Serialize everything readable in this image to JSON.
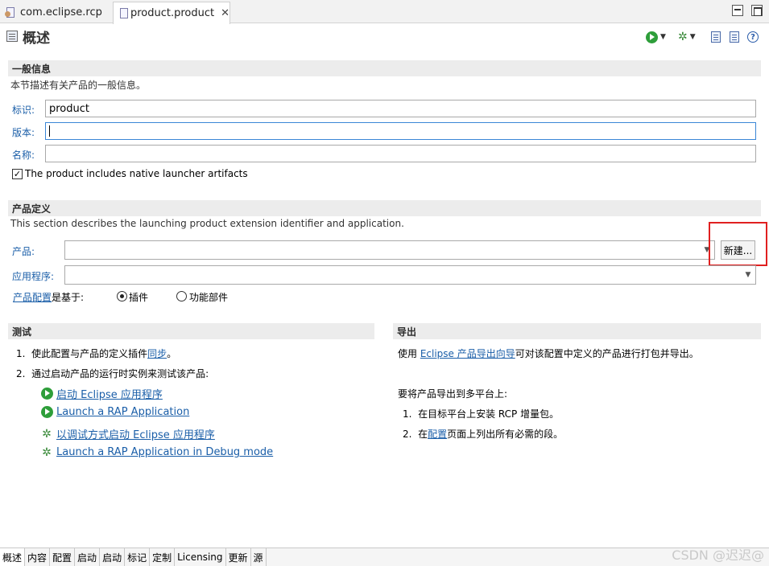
{
  "tabs": [
    {
      "label": "com.eclipse.rcp",
      "icon": "plugin-manifest-icon"
    },
    {
      "label": "product.product",
      "icon": "product-file-icon",
      "close": "✕"
    }
  ],
  "page": {
    "title": "概述"
  },
  "general": {
    "header": "一般信息",
    "description": "本节描述有关产品的一般信息。",
    "id_label": "标识:",
    "id_value": "product",
    "version_label": "版本:",
    "version_value": "",
    "name_label": "名称:",
    "name_value": "",
    "native_launcher_label": "The product includes native launcher artifacts",
    "native_launcher_checked": true
  },
  "definition": {
    "header": "产品定义",
    "description": "This section describes the launching product extension identifier and application.",
    "product_label": "产品:",
    "product_value": "",
    "new_button": "新建...",
    "application_label": "应用程序:",
    "application_value": "",
    "config_link": "产品配置",
    "based_on": "是基于:",
    "radio_plugin": "插件",
    "radio_feature": "功能部件",
    "selected": "插件"
  },
  "testing": {
    "header": "测试",
    "step1_num": "1.",
    "step1_prefix": "使此配置与产品的定义插件",
    "step1_link": "同步",
    "step1_suffix": "。",
    "step2_num": "2.",
    "step2": "通过启动产品的运行时实例来测试该产品:",
    "actions": [
      {
        "label": "启动 Eclipse 应用程序",
        "icon": "run-icon"
      },
      {
        "label": "Launch a RAP Application",
        "icon": "run-icon"
      },
      {
        "label": "以调试方式启动 Eclipse 应用程序",
        "icon": "debug-bug-icon"
      },
      {
        "label": "Launch a RAP Application in Debug mode",
        "icon": "debug-bug-icon"
      }
    ]
  },
  "export": {
    "header": "导出",
    "line1_prefix": "使用 ",
    "line1_link": "Eclipse 产品导出向导",
    "line1_suffix": "可对该配置中定义的产品进行打包并导出。",
    "multi_title": "要将产品导出到多平台上:",
    "step1_num": "1.",
    "step1": "在目标平台上安装 RCP 增量包。",
    "step2_num": "2.",
    "step2_prefix": "在",
    "step2_link": "配置",
    "step2_suffix": "页面上列出所有必需的段。"
  },
  "bottom_tabs": [
    "概述",
    "内容",
    "配置",
    "启动",
    "启动",
    "标记",
    "定制",
    "Licensing",
    "更新",
    "源"
  ],
  "active_bottom_tab": "概述",
  "watermark": "CSDN @迟迟@",
  "colors": {
    "link": "#1a5ea8",
    "section_header": "#ececec",
    "highlight_box": "#e02020",
    "run_green": "#2e9e3a"
  }
}
